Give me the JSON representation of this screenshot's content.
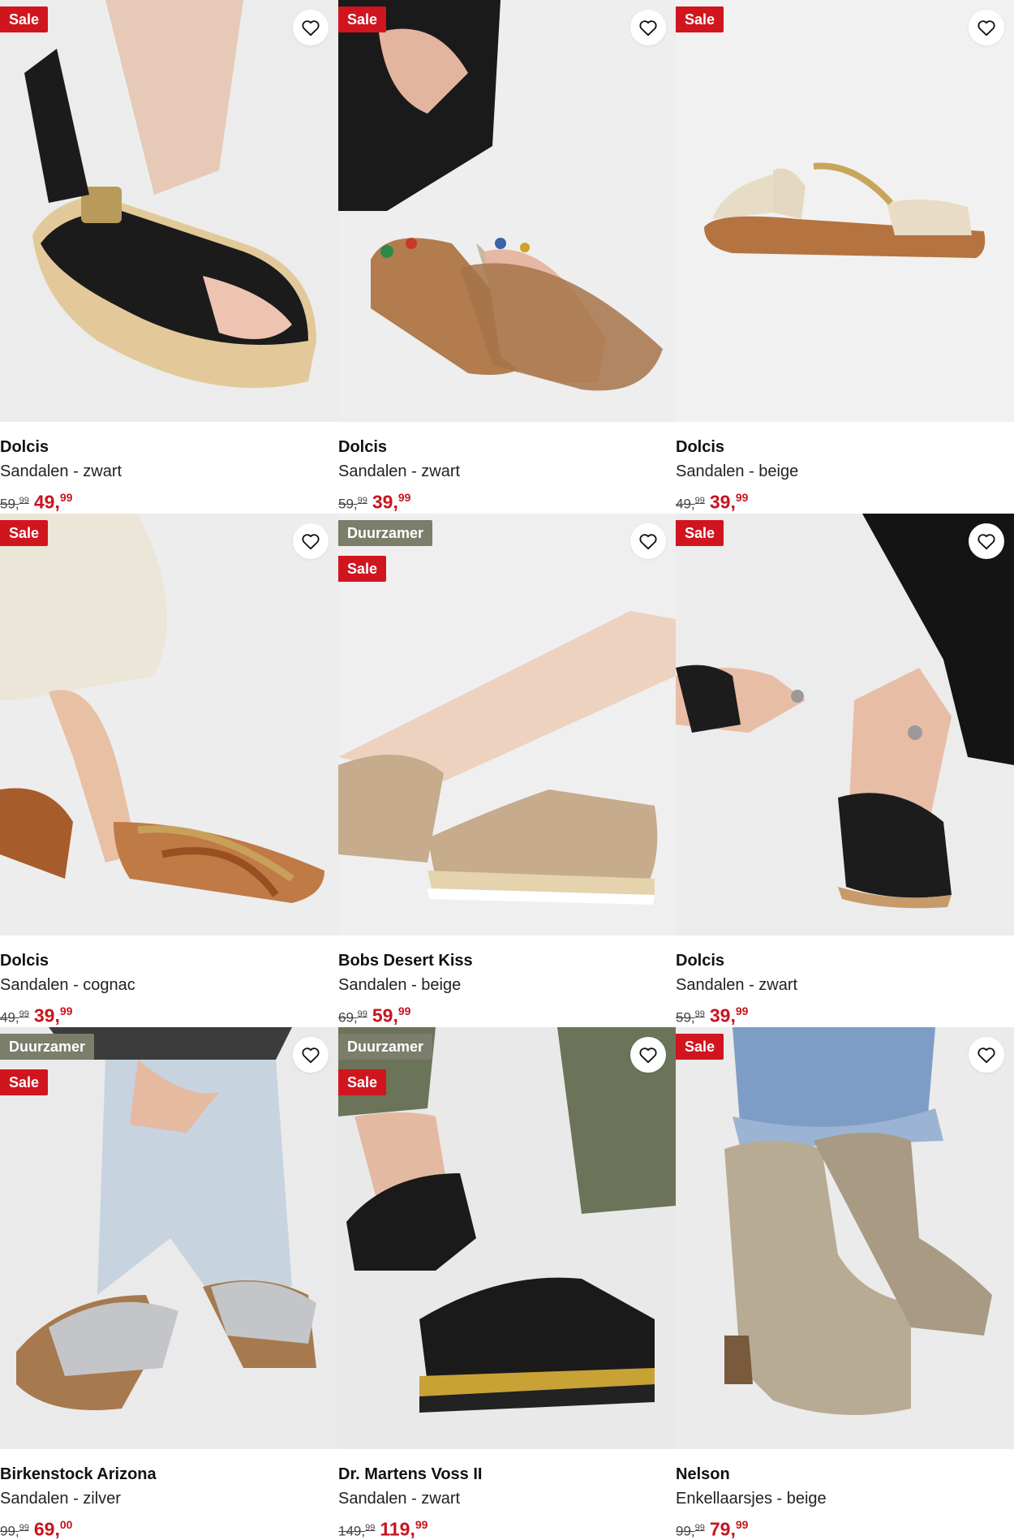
{
  "badges": {
    "sale": "Sale",
    "eco": "Duurzamer"
  },
  "colors": {
    "sale": "#d0151f",
    "eco": "#7c7d6a",
    "price": "#c8141e"
  },
  "products": [
    {
      "brand": "Dolcis",
      "desc": "Sandalen - zwart",
      "old_int": "59,",
      "old_dec": "99",
      "new_int": "49,",
      "new_dec": "99",
      "eco": false,
      "icon": "wedge-sandal-black"
    },
    {
      "brand": "Dolcis",
      "desc": "Sandalen - zwart",
      "old_int": "59,",
      "old_dec": "99",
      "new_int": "39,",
      "new_dec": "99",
      "eco": false,
      "icon": "jeweled-sandal"
    },
    {
      "brand": "Dolcis",
      "desc": "Sandalen - beige",
      "old_int": "49,",
      "old_dec": "99",
      "new_int": "39,",
      "new_dec": "99",
      "eco": false,
      "icon": "flat-sandal-beige"
    },
    {
      "brand": "Dolcis",
      "desc": "Sandalen - cognac",
      "old_int": "49,",
      "old_dec": "99",
      "new_int": "39,",
      "new_dec": "99",
      "eco": false,
      "icon": "strappy-sandal-cognac"
    },
    {
      "brand": "Bobs Desert Kiss",
      "desc": "Sandalen - beige",
      "old_int": "69,",
      "old_dec": "99",
      "new_int": "59,",
      "new_dec": "99",
      "eco": true,
      "icon": "knit-sandal-beige"
    },
    {
      "brand": "Dolcis",
      "desc": "Sandalen - zwart",
      "old_int": "59,",
      "old_dec": "99",
      "new_int": "39,",
      "new_dec": "99",
      "eco": false,
      "icon": "braided-sandal-black"
    },
    {
      "brand": "Birkenstock Arizona",
      "desc": "Sandalen - zilver",
      "old_int": "99,",
      "old_dec": "99",
      "new_int": "69,",
      "new_dec": "00",
      "eco": true,
      "icon": "slide-silver"
    },
    {
      "brand": "Dr. Martens Voss II",
      "desc": "Sandalen - zwart",
      "old_int": "149,",
      "old_dec": "99",
      "new_int": "119,",
      "new_dec": "99",
      "eco": true,
      "icon": "chunky-sandal-black"
    },
    {
      "brand": "Nelson",
      "desc": "Enkellaarsjes - beige",
      "old_int": "99,",
      "old_dec": "99",
      "new_int": "79,",
      "new_dec": "99",
      "eco": false,
      "icon": "western-boot-beige"
    }
  ]
}
